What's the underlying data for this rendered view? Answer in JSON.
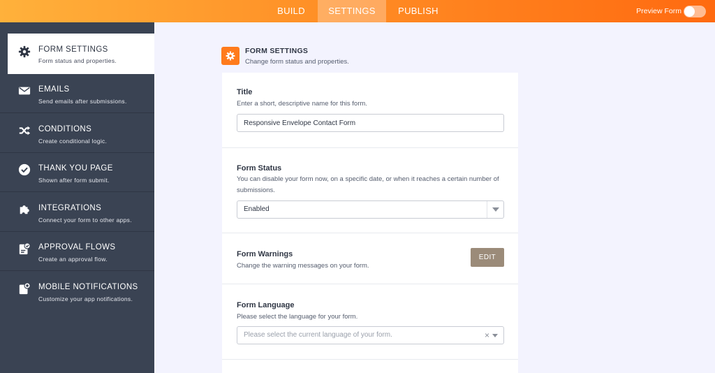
{
  "topbar": {
    "tabs": [
      "BUILD",
      "SETTINGS",
      "PUBLISH"
    ],
    "active_tab": "SETTINGS",
    "preview_label": "Preview Form"
  },
  "sidebar": {
    "items": [
      {
        "title": "FORM SETTINGS",
        "subtitle": "Form status and properties.",
        "icon": "gear-icon",
        "active": true
      },
      {
        "title": "EMAILS",
        "subtitle": "Send emails after submissions.",
        "icon": "envelope-icon"
      },
      {
        "title": "CONDITIONS",
        "subtitle": "Create conditional logic.",
        "icon": "shuffle-icon"
      },
      {
        "title": "THANK YOU PAGE",
        "subtitle": "Shown after form submit.",
        "icon": "check-circle-icon"
      },
      {
        "title": "INTEGRATIONS",
        "subtitle": "Connect your form to other apps.",
        "icon": "puzzle-icon"
      },
      {
        "title": "APPROVAL FLOWS",
        "subtitle": "Create an approval flow.",
        "icon": "clipboard-check-icon"
      },
      {
        "title": "MOBILE NOTIFICATIONS",
        "subtitle": "Customize your app notifications.",
        "icon": "mobile-notification-icon"
      }
    ]
  },
  "header": {
    "title": "FORM SETTINGS",
    "subtitle": "Change form status and properties."
  },
  "form": {
    "title_label": "Title",
    "title_desc": "Enter a short, descriptive name for this form.",
    "title_value": "Responsive Envelope Contact Form",
    "status_label": "Form Status",
    "status_desc": "You can disable your form now, on a specific date, or when it reaches a certain number of submissions.",
    "status_value": "Enabled",
    "warnings_label": "Form Warnings",
    "warnings_desc": "Change the warning messages on your form.",
    "edit_label": "EDIT",
    "language_label": "Form Language",
    "language_desc": "Please select the language for your form.",
    "language_placeholder": "Please select the current language of your form."
  },
  "colors": {
    "accent": "#ff7b1c",
    "sidebar_bg": "#3a4353",
    "edit_button": "#9b8b79"
  }
}
